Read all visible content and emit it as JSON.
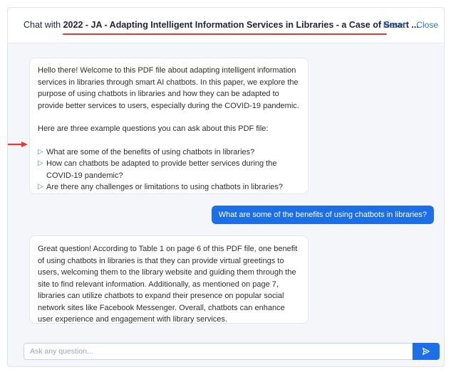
{
  "header": {
    "prefix": "Chat with",
    "document_title": "2022 - JA - Adapting Intelligent Information Services in Libraries - a Case of Smart ...",
    "reset_label": "Reset",
    "close_label": "Close"
  },
  "messages": {
    "welcome": {
      "intro": "Hello there! Welcome to this PDF file about adapting intelligent information services in libraries through smart AI chatbots. In this paper, we explore the purpose of using chatbots in libraries and how they can be adapted to provide better services to users, especially during the COVID-19 pandemic.",
      "lead_in": "Here are three example questions you can ask about this PDF file:",
      "questions": [
        "What are some of the benefits of using chatbots in libraries?",
        "How can chatbots be adapted to provide better services during the COVID-19 pandemic?",
        "Are there any challenges or limitations to using chatbots in libraries?"
      ]
    },
    "user_question": "What are some of the benefits of using chatbots in libraries?",
    "answer": "Great question! According to Table 1 on page 6 of this PDF file, one benefit of using chatbots in libraries is that they can provide virtual greetings to users, welcoming them to the library website and guiding them through the site to find relevant information. Additionally, as mentioned on page 7, libraries can utilize chatbots to expand their presence on popular social network sites like Facebook Messenger. Overall, chatbots can enhance user experience and engagement with library services."
  },
  "composer": {
    "placeholder": "Ask any question..."
  },
  "colors": {
    "accent": "#1d6fe8",
    "link": "#2f6fde",
    "annotation": "#e53935"
  },
  "icons": {
    "question": "play-triangle-icon",
    "send": "send-icon",
    "pointer": "red-arrow-icon"
  }
}
